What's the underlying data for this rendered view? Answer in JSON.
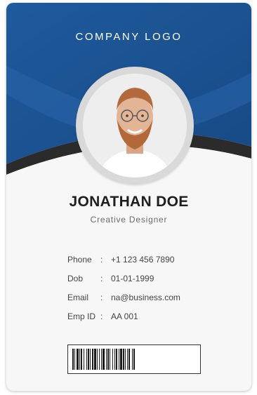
{
  "company": {
    "logo_text": "COMPANY LOGO"
  },
  "person": {
    "name": "JONATHAN DOE",
    "title": "Creative Designer"
  },
  "info": [
    {
      "label": "Phone",
      "value": "+1 123 456 7890"
    },
    {
      "label": "Dob",
      "value": "01-01-1999"
    },
    {
      "label": "Email",
      "value": "na@business.com"
    },
    {
      "label": "Emp ID",
      "value": "AA 001"
    }
  ],
  "colors": {
    "header_blue": "#1f5a9c",
    "header_dark_blue": "#174a86",
    "accent_dark": "#2b2b2b",
    "card_bg": "#f7f7f7"
  },
  "icons": {
    "photo": "profile-photo",
    "barcode": "barcode"
  }
}
